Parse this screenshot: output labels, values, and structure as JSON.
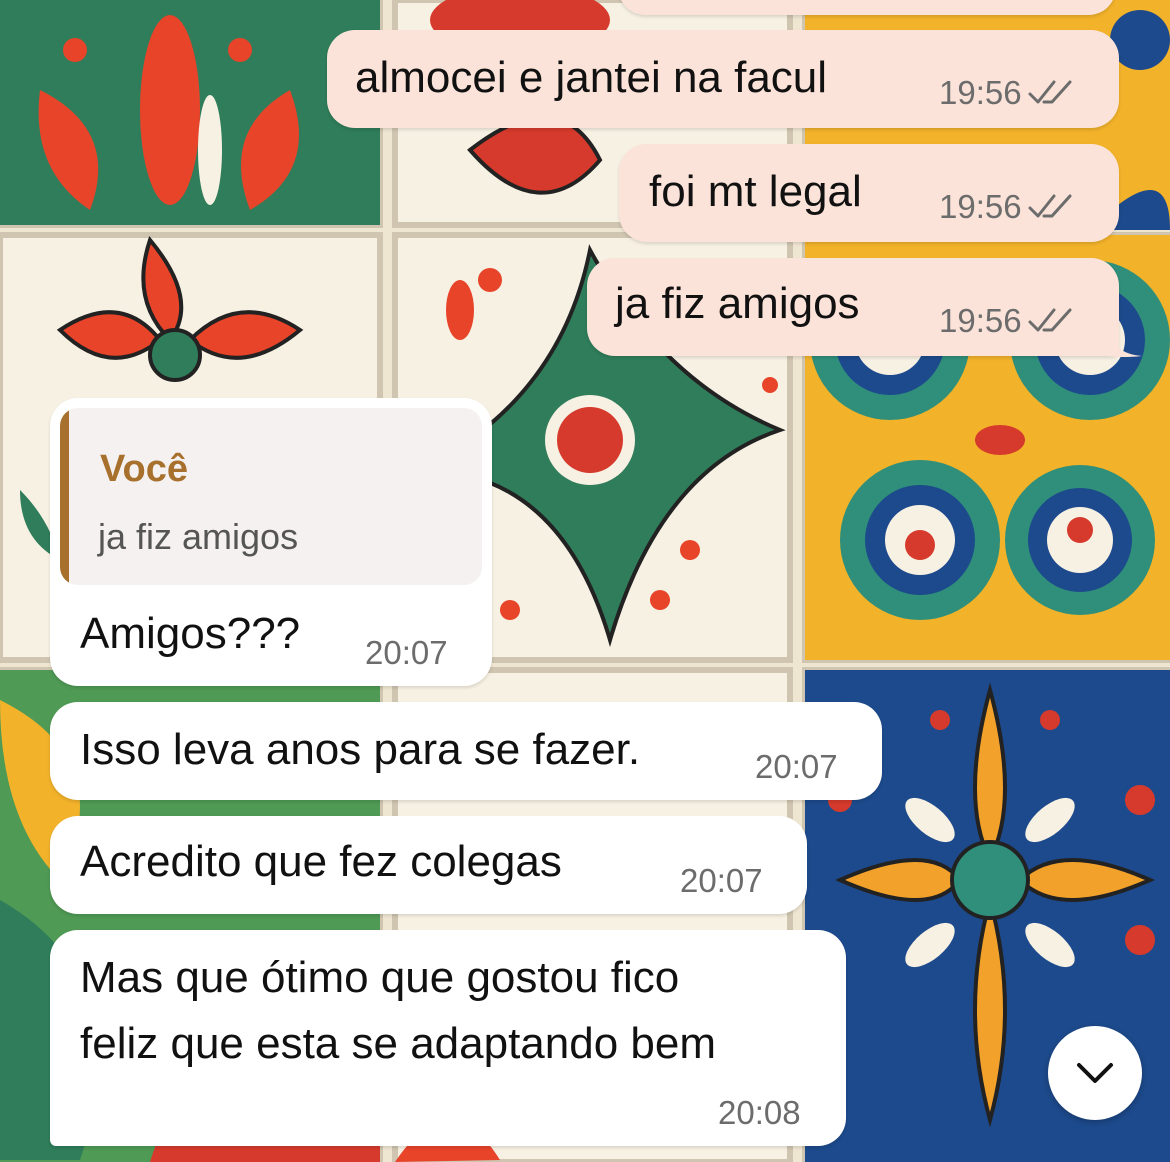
{
  "messages": [
    {
      "direction": "outgoing",
      "text": "almocei e jantei na facul",
      "time": "19:56",
      "status": "read"
    },
    {
      "direction": "outgoing",
      "text": "foi mt legal",
      "time": "19:56",
      "status": "read"
    },
    {
      "direction": "outgoing",
      "text": "ja fiz amigos",
      "time": "19:56",
      "status": "read"
    },
    {
      "direction": "incoming",
      "quote": {
        "author": "Você",
        "text": "ja fiz amigos"
      },
      "text": "Amigos???",
      "time": "20:07"
    },
    {
      "direction": "incoming",
      "text": "Isso leva anos para se fazer.",
      "time": "20:07"
    },
    {
      "direction": "incoming",
      "text": "Acredito que fez colegas",
      "time": "20:07"
    },
    {
      "direction": "incoming",
      "text_lines": [
        "Mas que ótimo que gostou fico",
        "feliz que esta se adaptando bem"
      ],
      "time": "20:08"
    }
  ],
  "scroll_button_icon": "chevron-down-icon",
  "colors": {
    "outgoing_bubble": "#fbe3d9",
    "incoming_bubble": "#ffffff",
    "quote_accent": "#a7702d"
  }
}
